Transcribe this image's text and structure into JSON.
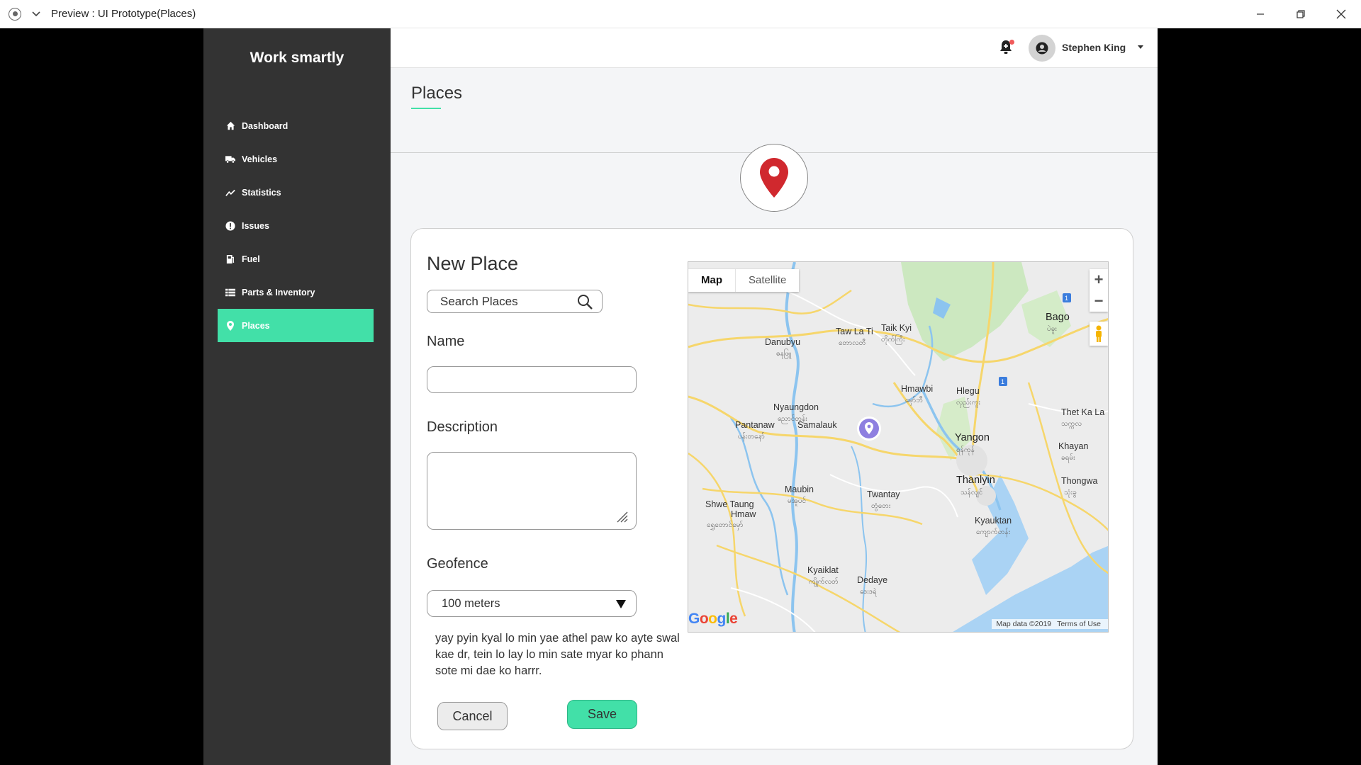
{
  "window": {
    "title": "Preview : UI Prototype(Places)"
  },
  "sidebar": {
    "brand": "Work smartly",
    "items": [
      {
        "label": "Dashboard",
        "icon": "home-icon"
      },
      {
        "label": "Vehicles",
        "icon": "truck-icon"
      },
      {
        "label": "Statistics",
        "icon": "chart-line-icon"
      },
      {
        "label": "Issues",
        "icon": "exclamation-circle-icon"
      },
      {
        "label": "Fuel",
        "icon": "gas-pump-icon"
      },
      {
        "label": "Parts & Inventory",
        "icon": "grid-list-icon"
      },
      {
        "label": "Places",
        "icon": "map-pin-icon",
        "active": true
      }
    ],
    "active_color": "#42e0a8"
  },
  "header": {
    "user_name": "Stephen King",
    "notification_badge_color": "#f05a5a"
  },
  "page": {
    "title": "Places"
  },
  "form": {
    "title": "New Place",
    "search_placeholder": "Search Places",
    "name_label": "Name",
    "name_value": "",
    "description_label": "Description",
    "description_value": "",
    "geofence_label": "Geofence",
    "geofence_value": "100 meters",
    "note": "yay pyin kyal lo min yae athel paw ko ayte swal kae dr, tein lo lay lo min sate myar ko phann sote mi dae ko harrr.",
    "cancel_label": "Cancel",
    "save_label": "Save"
  },
  "map": {
    "type_buttons": [
      "Map",
      "Satellite"
    ],
    "zoom_in": "+",
    "zoom_out": "−",
    "labels": {
      "bago": "Bago",
      "bago_mm": "ပဲခူး",
      "taik_kyi": "Taik Kyi",
      "taik_kyi_mm": "တိုက်ကြီး",
      "taw_la_ti": "Taw La Ti",
      "taw_la_ti_mm": "တောလတီ",
      "danubyu": "Danubyu",
      "danubyu_mm": "ဓနုဖြူ",
      "hmawbi": "Hmawbi",
      "hmawbi_mm": "မှော်ဘီ",
      "hlegu": "Hlegu",
      "hlegu_mm": "လှည်းကူး",
      "nyaungdon": "Nyaungdon",
      "nyaungdon_mm": "ညောင်တုန်း",
      "pantanaw": "Pantanaw",
      "pantanaw_mm": "ပန်းတနော်",
      "samalauk": "Samalauk",
      "thet_ka_la": "Thet Ka La",
      "thet_ka_la_mm": "သက္ကလ",
      "yangon": "Yangon",
      "yangon_mm": "ရန်ကုန်",
      "khayan": "Khayan",
      "khayan_mm": "ခရမ်း",
      "thanlyin": "Thanlyin",
      "thanlyin_mm": "သန်လျင်",
      "thongwa": "Thongwa",
      "thongwa_mm": "သုံးခွ",
      "maubin": "Maubin",
      "maubin_mm": "မအူပင်",
      "twantay": "Twantay",
      "twantay_mm": "တွံတေး",
      "shwe_taung": "Shwe Taung",
      "hmaw": "Hmaw",
      "shwe_taung_mm": "ရွှေတောင်မှော်",
      "kyauktan": "Kyauktan",
      "kyauktan_mm": "ကျောက်တန်း",
      "kyaiklat": "Kyaiklat",
      "kyaiklat_mm": "ကျိုက်လတ်",
      "dedaye": "Dedaye",
      "dedaye_mm": "ဒေးဒရဲ",
      "road_shield": "1"
    },
    "google_logo": "Google",
    "attribution": "Map data ©2019",
    "terms": "Terms of Use"
  },
  "colors": {
    "accent": "#42e0a8",
    "pin_red": "#d0282e",
    "pin_purple": "#8e7fe0"
  }
}
